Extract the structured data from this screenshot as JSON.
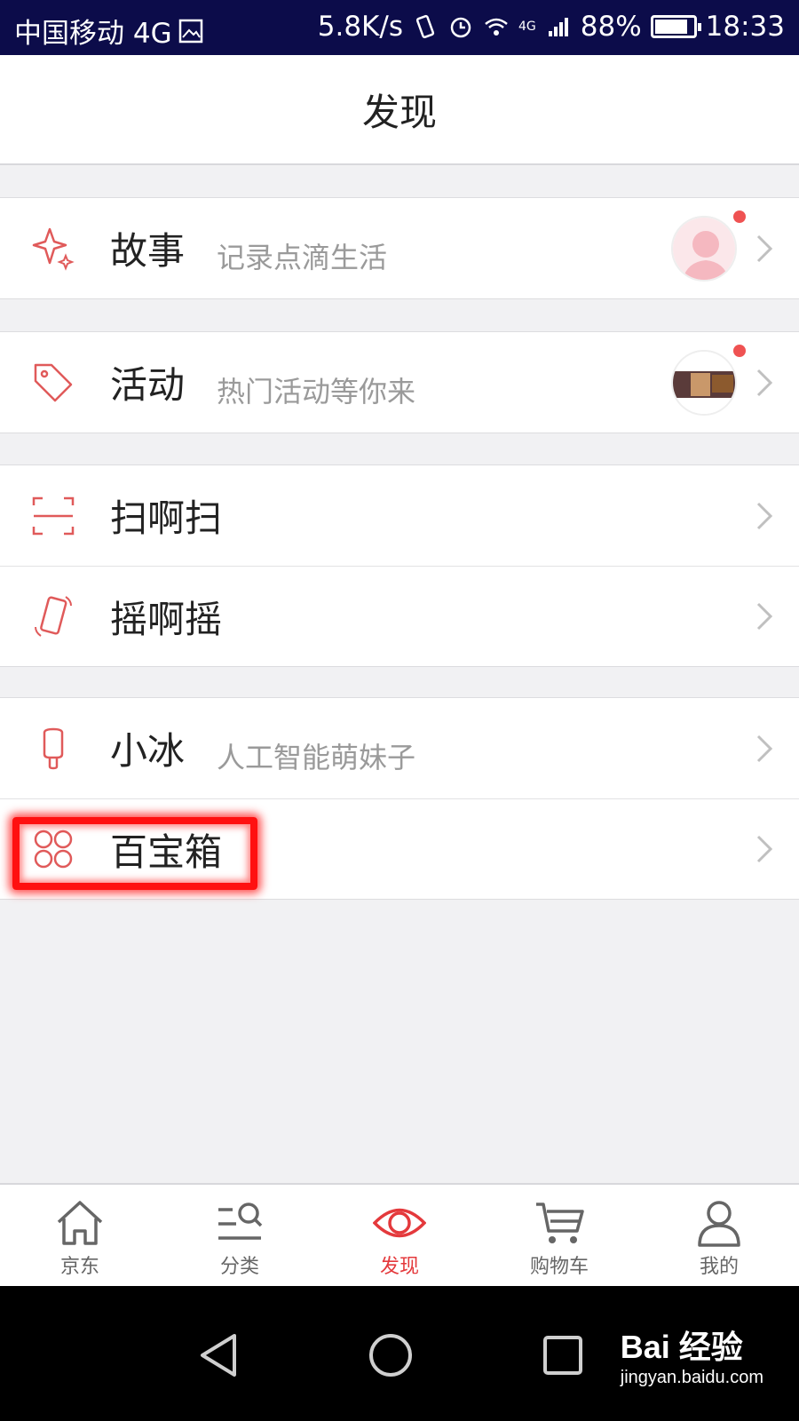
{
  "status_bar": {
    "carrier": "中国移动 4G",
    "net_speed": "5.8K/s",
    "network_type": "4G",
    "battery": "88%",
    "time": "18:33"
  },
  "header": {
    "title": "发现"
  },
  "menu": {
    "story": {
      "label": "故事",
      "subtitle": "记录点滴生活",
      "icon": "sparkle-icon",
      "has_badge": true
    },
    "activity": {
      "label": "活动",
      "subtitle": "热门活动等你来",
      "icon": "tag-icon",
      "has_badge": true
    },
    "scan": {
      "label": "扫啊扫",
      "icon": "scan-icon"
    },
    "shake": {
      "label": "摇啊摇",
      "icon": "shake-phone-icon"
    },
    "xiaobing": {
      "label": "小冰",
      "subtitle": "人工智能萌妹子",
      "icon": "popsicle-icon"
    },
    "toolbox": {
      "label": "百宝箱",
      "icon": "grid-circles-icon"
    }
  },
  "tabs": [
    {
      "label": "京东",
      "icon": "home-icon"
    },
    {
      "label": "分类",
      "icon": "category-search-icon"
    },
    {
      "label": "发现",
      "icon": "eye-icon",
      "active": true
    },
    {
      "label": "购物车",
      "icon": "cart-icon"
    },
    {
      "label": "我的",
      "icon": "user-icon"
    }
  ],
  "watermark": {
    "main": "Bai 经验",
    "sub": "jingyan.baidu.com"
  },
  "colors": {
    "accent": "#e4393c",
    "icon_red": "#e05a5a",
    "highlight": "#ff1010"
  }
}
